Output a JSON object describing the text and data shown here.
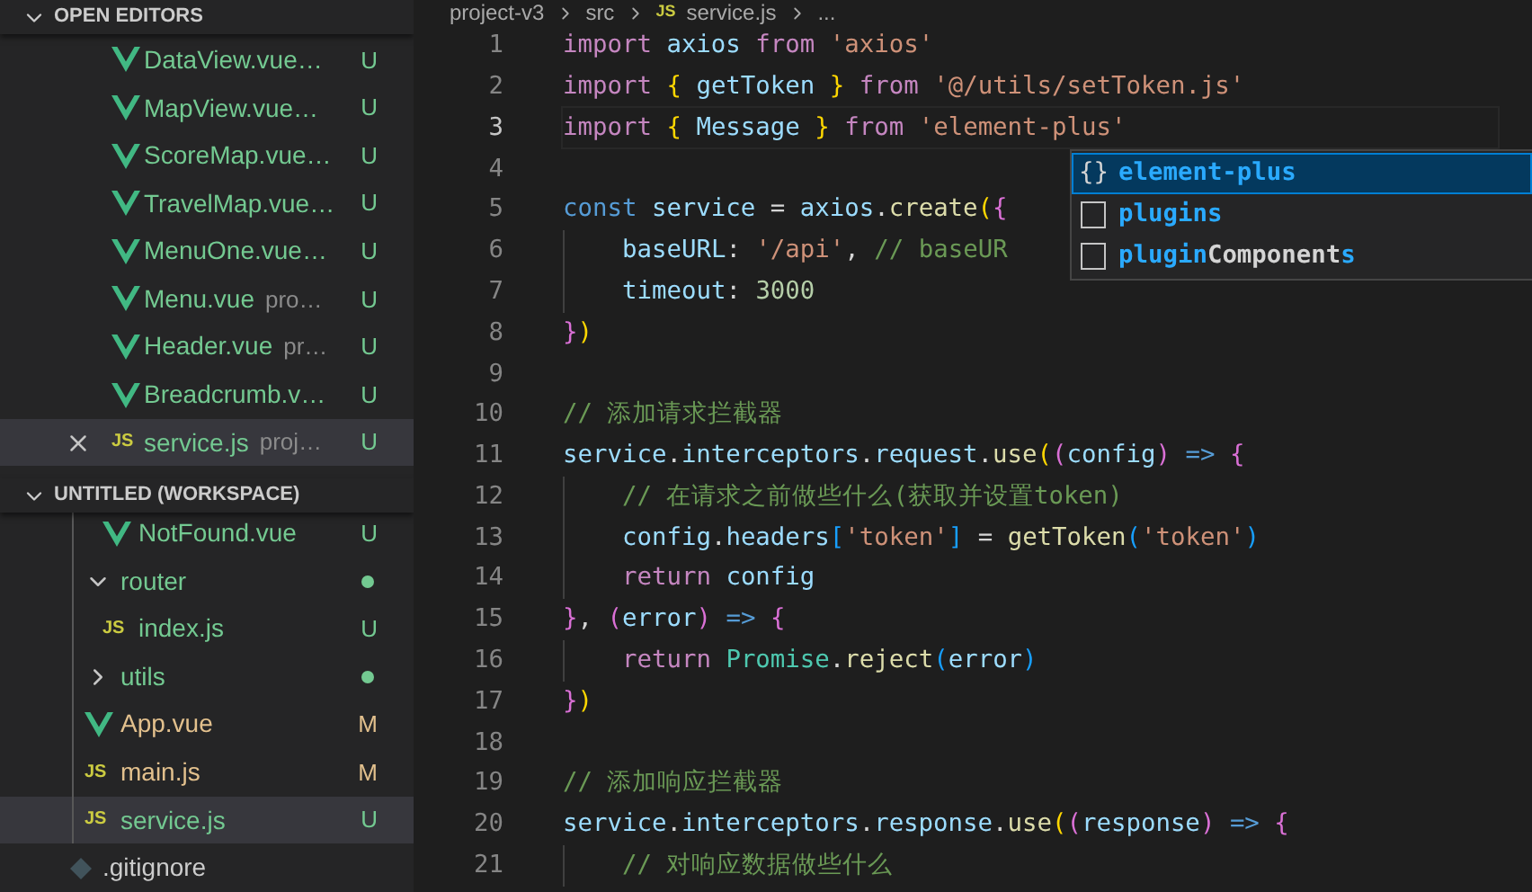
{
  "sidebar": {
    "open_editors": {
      "title": "OPEN EDITORS",
      "expanded": true,
      "items": [
        {
          "kind": "vue",
          "name": "DataView.vue…",
          "color": "#73c991",
          "status": "U",
          "selected": false
        },
        {
          "kind": "vue",
          "name": "MapView.vue…",
          "color": "#73c991",
          "status": "U",
          "selected": false
        },
        {
          "kind": "vue",
          "name": "ScoreMap.vue…",
          "color": "#73c991",
          "status": "U",
          "selected": false
        },
        {
          "kind": "vue",
          "name": "TravelMap.vue…",
          "color": "#73c991",
          "status": "U",
          "selected": false
        },
        {
          "kind": "vue",
          "name": "MenuOne.vue…",
          "color": "#73c991",
          "status": "U",
          "selected": false
        },
        {
          "kind": "vue",
          "name": "Menu.vue",
          "detail": "pro…",
          "color": "#73c991",
          "status": "U",
          "selected": false
        },
        {
          "kind": "vue",
          "name": "Header.vue",
          "detail": "pr…",
          "color": "#73c991",
          "status": "U",
          "selected": false
        },
        {
          "kind": "vue",
          "name": "Breadcrumb.v…",
          "color": "#73c991",
          "status": "U",
          "selected": false
        },
        {
          "kind": "js",
          "icon_text": "JS",
          "name": "service.js",
          "detail": "proj…",
          "color": "#73c991",
          "status": "U",
          "selected": true
        }
      ]
    },
    "workspace": {
      "title": "UNTITLED (WORKSPACE)",
      "expanded": true,
      "items": [
        {
          "kind": "group",
          "children": [
            {
              "kind": "group",
              "children": [
                {
                  "kind": "vue",
                  "name": "NotFound.vue",
                  "color": "#73c991",
                  "status": "U",
                  "selected": false
                }
              ]
            },
            {
              "kind": "folder",
              "name": "router",
              "expanded": true,
              "color": "#73c991",
              "selected": false,
              "children": [
                {
                  "kind": "js",
                  "icon_text": "JS",
                  "name": "index.js",
                  "color": "#73c991",
                  "status": "U",
                  "selected": false
                }
              ]
            },
            {
              "kind": "folder",
              "name": "utils",
              "expanded": false,
              "color": "#73c991",
              "selected": false
            },
            {
              "kind": "vue",
              "name": "App.vue",
              "color": "#e2c08d",
              "status": "M",
              "selected": false
            },
            {
              "kind": "js",
              "icon_text": "JS",
              "name": "main.js",
              "color": "#e2c08d",
              "status": "M",
              "selected": false
            },
            {
              "kind": "js",
              "icon_text": "JS",
              "name": "service.js",
              "color": "#73c991",
              "status": "U",
              "selected": true
            }
          ]
        },
        {
          "kind": "git",
          "name": ".gitignore",
          "color": "#cccccc",
          "selected": false
        }
      ]
    }
  },
  "editor": {
    "breadcrumb": [
      {
        "text": "project-v3"
      },
      {
        "text": "src"
      },
      {
        "text": "service.js",
        "icon_text": "JS"
      },
      {
        "text": "..."
      }
    ],
    "lines": [
      {
        "number": "1",
        "current": false,
        "text": "import axios from 'axios'"
      },
      {
        "number": "2",
        "current": false,
        "text": "import { getToken } from '@/utils/setToken.js'"
      },
      {
        "number": "3",
        "current": true,
        "text": "import { Message } from 'element-plus'"
      },
      {
        "number": "4",
        "current": false
      },
      {
        "number": "5",
        "current": false,
        "text": "const service = axios.create({"
      },
      {
        "number": "6",
        "current": false,
        "text": "    baseURL: '/api', // baseUR"
      },
      {
        "number": "7",
        "current": false,
        "text": "    timeout: 3000"
      },
      {
        "number": "8",
        "current": false,
        "text": "})"
      },
      {
        "number": "9",
        "current": false
      },
      {
        "number": "10",
        "current": false,
        "text": "// 添加请求拦截器"
      },
      {
        "number": "11",
        "current": false,
        "text": "service.interceptors.request.use((config) => {"
      },
      {
        "number": "12",
        "current": false,
        "text": "    // 在请求之前做些什么(获取并设置token)"
      },
      {
        "number": "13",
        "current": false,
        "text": "    config.headers['token'] = getToken('token')"
      },
      {
        "number": "14",
        "current": false,
        "text": "    return config"
      },
      {
        "number": "15",
        "current": false,
        "text": "}, (error) => {"
      },
      {
        "number": "16",
        "current": false,
        "text": "    return Promise.reject(error)"
      },
      {
        "number": "17",
        "current": false,
        "text": "})"
      },
      {
        "number": "18",
        "current": false
      },
      {
        "number": "19",
        "current": false,
        "text": "// 添加响应拦截器"
      },
      {
        "number": "20",
        "current": false,
        "text": "service.interceptors.response.use((response) => {"
      },
      {
        "number": "21",
        "current": false,
        "text": "    // 对响应数据做些什么"
      }
    ],
    "suggestions": [
      {
        "kind": "module",
        "icon_text": "{}",
        "selected": true,
        "label": "**element-plus**"
      },
      {
        "kind": "text",
        "selected": false,
        "label": "**plugins**"
      },
      {
        "kind": "text",
        "selected": false,
        "label": "**plugin**Component**s**"
      }
    ]
  }
}
